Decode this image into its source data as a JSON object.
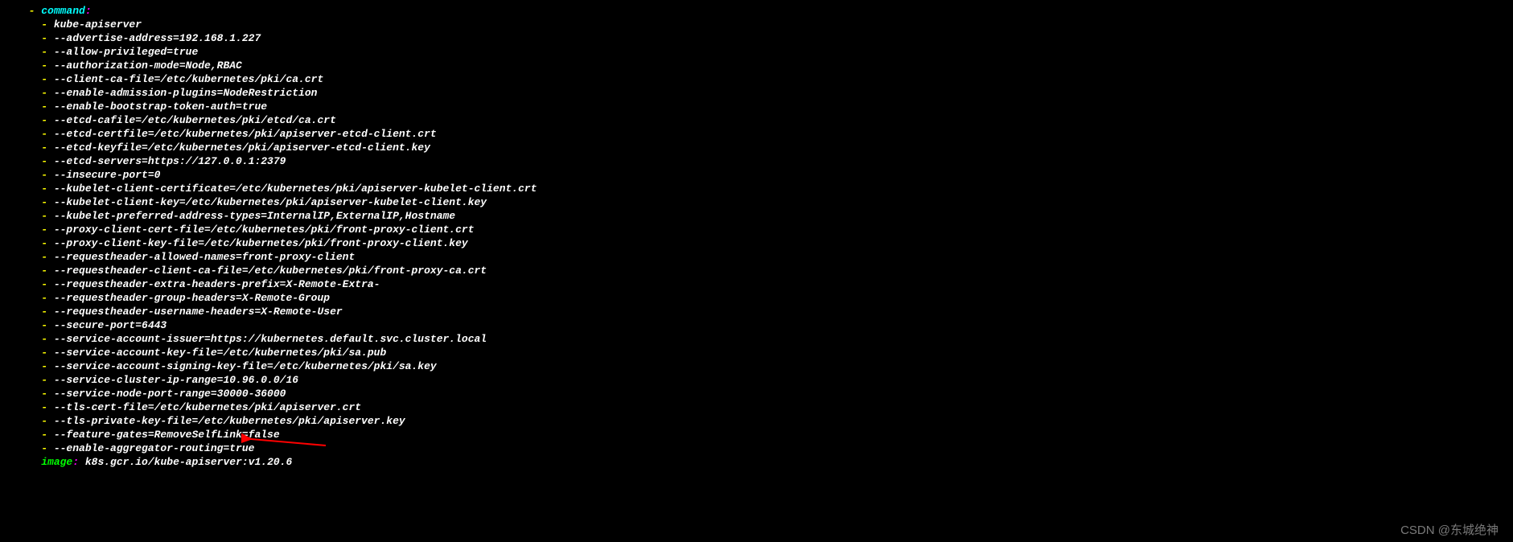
{
  "yaml": {
    "command_key": "command",
    "items": [
      "kube-apiserver",
      "--advertise-address=192.168.1.227",
      "--allow-privileged=true",
      "--authorization-mode=Node,RBAC",
      "--client-ca-file=/etc/kubernetes/pki/ca.crt",
      "--enable-admission-plugins=NodeRestriction",
      "--enable-bootstrap-token-auth=true",
      "--etcd-cafile=/etc/kubernetes/pki/etcd/ca.crt",
      "--etcd-certfile=/etc/kubernetes/pki/apiserver-etcd-client.crt",
      "--etcd-keyfile=/etc/kubernetes/pki/apiserver-etcd-client.key",
      "--etcd-servers=https://127.0.0.1:2379",
      "--insecure-port=0",
      "--kubelet-client-certificate=/etc/kubernetes/pki/apiserver-kubelet-client.crt",
      "--kubelet-client-key=/etc/kubernetes/pki/apiserver-kubelet-client.key",
      "--kubelet-preferred-address-types=InternalIP,ExternalIP,Hostname",
      "--proxy-client-cert-file=/etc/kubernetes/pki/front-proxy-client.crt",
      "--proxy-client-key-file=/etc/kubernetes/pki/front-proxy-client.key",
      "--requestheader-allowed-names=front-proxy-client",
      "--requestheader-client-ca-file=/etc/kubernetes/pki/front-proxy-ca.crt",
      "--requestheader-extra-headers-prefix=X-Remote-Extra-",
      "--requestheader-group-headers=X-Remote-Group",
      "--requestheader-username-headers=X-Remote-User",
      "--secure-port=6443",
      "--service-account-issuer=https://kubernetes.default.svc.cluster.local",
      "--service-account-key-file=/etc/kubernetes/pki/sa.pub",
      "--service-account-signing-key-file=/etc/kubernetes/pki/sa.key",
      "--service-cluster-ip-range=10.96.0.0/16",
      "--service-node-port-range=30000-36000",
      "--tls-cert-file=/etc/kubernetes/pki/apiserver.crt",
      "--tls-private-key-file=/etc/kubernetes/pki/apiserver.key",
      "--feature-gates=RemoveSelfLink=false",
      "--enable-aggregator-routing=true"
    ],
    "image_key": "image",
    "image_value": " k8s.gcr.io/kube-apiserver:v1.20.6"
  },
  "watermark": "CSDN @东城绝神"
}
